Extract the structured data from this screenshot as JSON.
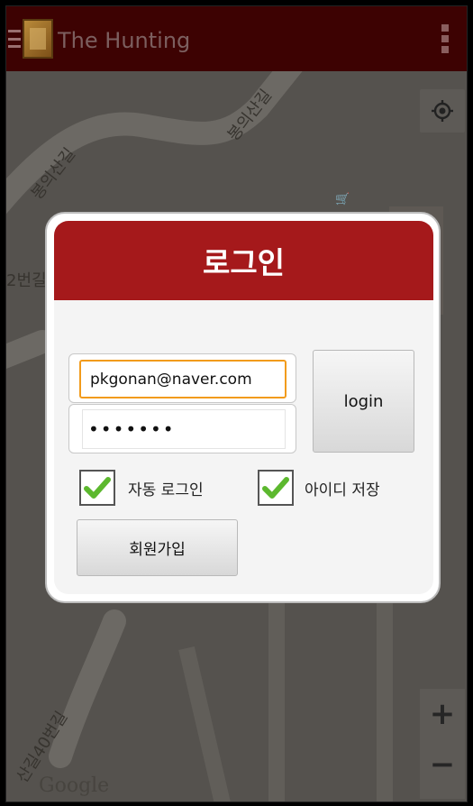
{
  "app": {
    "title": "The Hunting"
  },
  "map": {
    "labels": [
      "봉의산길",
      "봉의산길",
      "2번길",
      "산길40번길"
    ],
    "google": "Google"
  },
  "dialog": {
    "title": "로그인",
    "email_value": "pkgonan@naver.com",
    "password_value": "•••••••",
    "login_label": "login",
    "auto_login_label": "자동 로그인",
    "auto_login_checked": true,
    "save_id_label": "아이디 저장",
    "save_id_checked": true,
    "signup_label": "회원가입"
  },
  "colors": {
    "header_red": "#a5191b",
    "action_bar": "#3d0202",
    "focus_orange": "#f29b1b",
    "check_green": "#5cb82e"
  }
}
